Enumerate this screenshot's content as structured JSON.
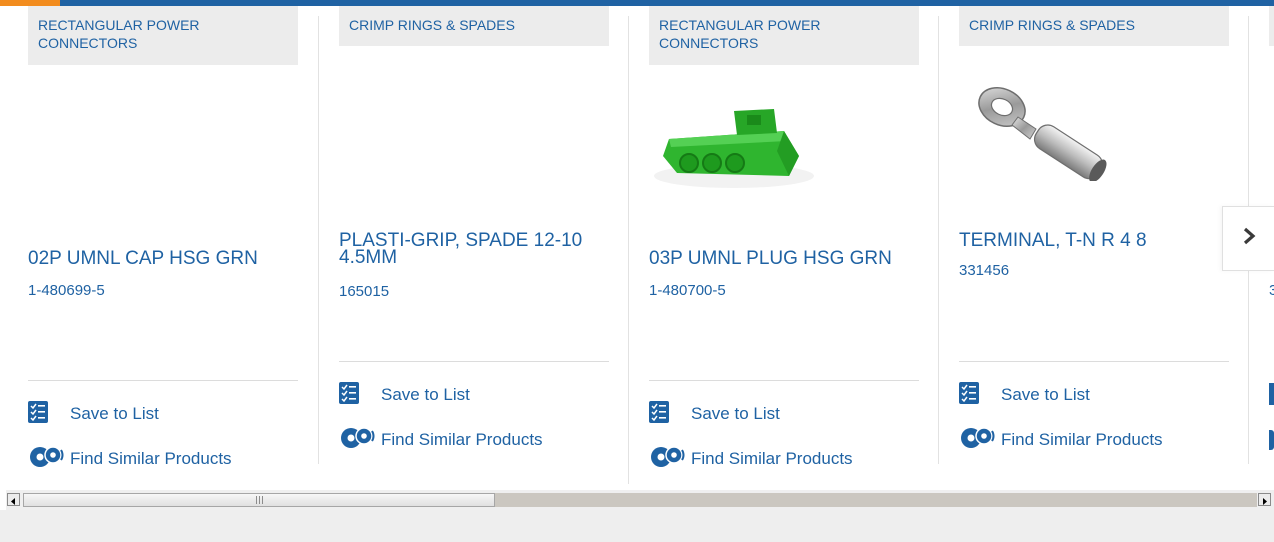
{
  "cards": [
    {
      "category": "RECTANGULAR POWER CONNECTORS",
      "title": "02P UMNL CAP HSG GRN",
      "part_number": "1-480699-5",
      "image_icon": "none",
      "actions": {
        "save": "Save to List",
        "find": "Find Similar Products"
      }
    },
    {
      "category": "CRIMP RINGS & SPADES",
      "title": "PLASTI-GRIP, SPADE 12-10 4.5MM",
      "part_number": "165015",
      "image_icon": "none",
      "actions": {
        "save": "Save to List",
        "find": "Find Similar Products"
      }
    },
    {
      "category": "RECTANGULAR POWER CONNECTORS",
      "title": "03P UMNL PLUG HSG GRN",
      "part_number": "1-480700-5",
      "image_icon": "green-connector-image",
      "actions": {
        "save": "Save to List",
        "find": "Find Similar Products"
      }
    },
    {
      "category": "CRIMP RINGS & SPADES",
      "title": "TERMINAL, T-N R 4 8",
      "part_number": "331456",
      "image_icon": "ring-terminal-image",
      "actions": {
        "save": "Save to List",
        "find": "Find Similar Products"
      }
    }
  ],
  "partial_card": {
    "part_number_fragment": "3"
  },
  "next_button_icon": "chevron-right-icon",
  "colors": {
    "link_blue": "#1f62a3",
    "accent_orange": "#f28c1e",
    "connector_green": "#2fb52f",
    "category_bg": "#ececec"
  }
}
